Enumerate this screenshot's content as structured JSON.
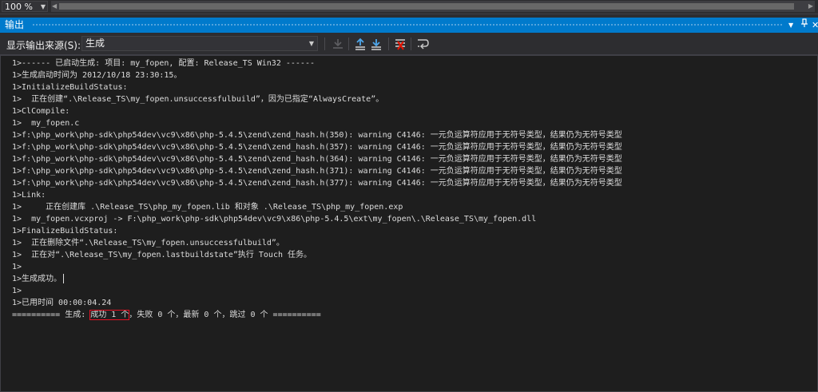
{
  "toolbar_top": {
    "zoom": "100 %"
  },
  "panel": {
    "title": "输出"
  },
  "source": {
    "label": "显示输出来源(S):",
    "selected": "生成"
  },
  "output_lines": [
    "1>------ 已启动生成: 项目: my_fopen, 配置: Release_TS Win32 ------",
    "1>生成启动时间为 2012/10/18 23:30:15。",
    "1>InitializeBuildStatus:",
    "1>  正在创建“.\\Release_TS\\my_fopen.unsuccessfulbuild”，因为已指定“AlwaysCreate”。",
    "1>ClCompile:",
    "1>  my_fopen.c",
    "1>f:\\php_work\\php-sdk\\php54dev\\vc9\\x86\\php-5.4.5\\zend\\zend_hash.h(350): warning C4146: 一元负运算符应用于无符号类型，结果仍为无符号类型",
    "1>f:\\php_work\\php-sdk\\php54dev\\vc9\\x86\\php-5.4.5\\zend\\zend_hash.h(357): warning C4146: 一元负运算符应用于无符号类型，结果仍为无符号类型",
    "1>f:\\php_work\\php-sdk\\php54dev\\vc9\\x86\\php-5.4.5\\zend\\zend_hash.h(364): warning C4146: 一元负运算符应用于无符号类型，结果仍为无符号类型",
    "1>f:\\php_work\\php-sdk\\php54dev\\vc9\\x86\\php-5.4.5\\zend\\zend_hash.h(371): warning C4146: 一元负运算符应用于无符号类型，结果仍为无符号类型",
    "1>f:\\php_work\\php-sdk\\php54dev\\vc9\\x86\\php-5.4.5\\zend\\zend_hash.h(377): warning C4146: 一元负运算符应用于无符号类型，结果仍为无符号类型",
    "1>Link:",
    "1>     正在创建库 .\\Release_TS\\php_my_fopen.lib 和对象 .\\Release_TS\\php_my_fopen.exp",
    "1>  my_fopen.vcxproj -> F:\\php_work\\php-sdk\\php54dev\\vc9\\x86\\php-5.4.5\\ext\\my_fopen\\.\\Release_TS\\my_fopen.dll",
    "1>FinalizeBuildStatus:",
    "1>  正在删除文件“.\\Release_TS\\my_fopen.unsuccessfulbuild”。",
    "1>  正在对“.\\Release_TS\\my_fopen.lastbuildstate”执行 Touch 任务。",
    "1>",
    "1>生成成功。",
    "1>",
    "1>已用时间 00:00:04.24"
  ],
  "summary": {
    "prefix": "========== 生成: ",
    "highlight": "成功 1 个",
    "suffix": "，失败 0 个，最新 0 个，跳过 0 个 =========="
  },
  "colors": {
    "accent": "#007acc",
    "highlight_box": "#e81123",
    "text": "#dcdcdc",
    "background": "#1e1e1e"
  },
  "icons": [
    "pin-icon",
    "close-icon",
    "dropdown-icon",
    "find-message-icon",
    "prev-message-icon",
    "next-message-icon",
    "clear-all-icon",
    "word-wrap-icon"
  ]
}
